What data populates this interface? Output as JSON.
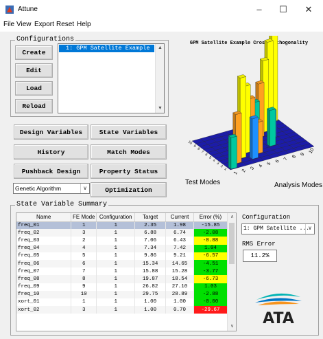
{
  "window": {
    "title": "Attune",
    "minimize": "–",
    "maximize": "☐",
    "close": "✕"
  },
  "menu": [
    "File",
    "View",
    "Export",
    "Reset",
    "Help"
  ],
  "configurations": {
    "legend": "Configurations",
    "buttons": {
      "create": "Create",
      "edit": "Edit",
      "load": "Load",
      "reload": "Reload"
    },
    "list_items": [
      "1: GPM Satellite Example"
    ]
  },
  "actions": {
    "design_variables": "Design Variables",
    "state_variables": "State Variables",
    "history": "History",
    "match_modes": "Match Modes",
    "pushback_design": "Pushback Design",
    "property_status": "Property Status",
    "optimization": "Optimization",
    "algorithm_select": "Genetic Algorithm"
  },
  "chart_data": {
    "type": "bar",
    "title": "GPM Satellite Example Cross-orthogonality",
    "xlabel": "Test Modes",
    "ylabel": "Analysis Modes",
    "analysis_ticks": [
      "1",
      "2",
      "3",
      "4",
      "5",
      "6",
      "7",
      "8",
      "9",
      "10"
    ],
    "test_ticks": [
      "1",
      "2",
      "3",
      "4",
      "5",
      "6",
      "7",
      "8",
      "9",
      "10"
    ],
    "diagonal_values": [
      0.35,
      0.55,
      0.9,
      0.75,
      0.55,
      0.45,
      0.6,
      0.8,
      0.95,
      1.0
    ],
    "colors": {
      "high": "#ffff00",
      "mid": "#00c8a0",
      "low": "#2020c0",
      "blue": "#1e90ff",
      "orange": "#ffa020"
    }
  },
  "summary": {
    "legend": "State Variable Summary",
    "columns": [
      "Name",
      "FE Mode",
      "Configuration",
      "Target",
      "Current",
      "Error (%)"
    ],
    "rows": [
      {
        "name": "freq_01",
        "mode": "1",
        "config": "1",
        "target": "2.35",
        "current": "1.98",
        "error": "-15.85",
        "status": "none"
      },
      {
        "name": "freq_02",
        "mode": "3",
        "config": "1",
        "target": "6.88",
        "current": "6.74",
        "error": "-2.08",
        "status": "green"
      },
      {
        "name": "freq_03",
        "mode": "2",
        "config": "1",
        "target": "7.06",
        "current": "6.43",
        "error": "-8.88",
        "status": "yellow"
      },
      {
        "name": "freq_04",
        "mode": "4",
        "config": "1",
        "target": "7.34",
        "current": "7.42",
        "error": "1.04",
        "status": "green"
      },
      {
        "name": "freq_05",
        "mode": "5",
        "config": "1",
        "target": "9.86",
        "current": "9.21",
        "error": "-6.57",
        "status": "yellow"
      },
      {
        "name": "freq_06",
        "mode": "6",
        "config": "1",
        "target": "15.34",
        "current": "14.65",
        "error": "-4.51",
        "status": "green"
      },
      {
        "name": "freq_07",
        "mode": "7",
        "config": "1",
        "target": "15.88",
        "current": "15.28",
        "error": "-3.77",
        "status": "green"
      },
      {
        "name": "freq_08",
        "mode": "8",
        "config": "1",
        "target": "19.87",
        "current": "18.54",
        "error": "-6.73",
        "status": "yellow"
      },
      {
        "name": "freq_09",
        "mode": "9",
        "config": "1",
        "target": "26.82",
        "current": "27.10",
        "error": "1.03",
        "status": "green"
      },
      {
        "name": "freq_10",
        "mode": "10",
        "config": "1",
        "target": "29.75",
        "current": "28.89",
        "error": "-2.88",
        "status": "green"
      },
      {
        "name": "xort_01",
        "mode": "1",
        "config": "1",
        "target": "1.00",
        "current": "1.00",
        "error": "-0.00",
        "status": "green"
      },
      {
        "name": "xort_02",
        "mode": "3",
        "config": "1",
        "target": "1.00",
        "current": "0.70",
        "error": "-29.67",
        "status": "red"
      }
    ],
    "configuration_label": "Configuration",
    "configuration_value": "1: GPM Satellite ...",
    "rms_label": "RMS Error",
    "rms_value": "11.2%",
    "logo_text": "ATA"
  }
}
